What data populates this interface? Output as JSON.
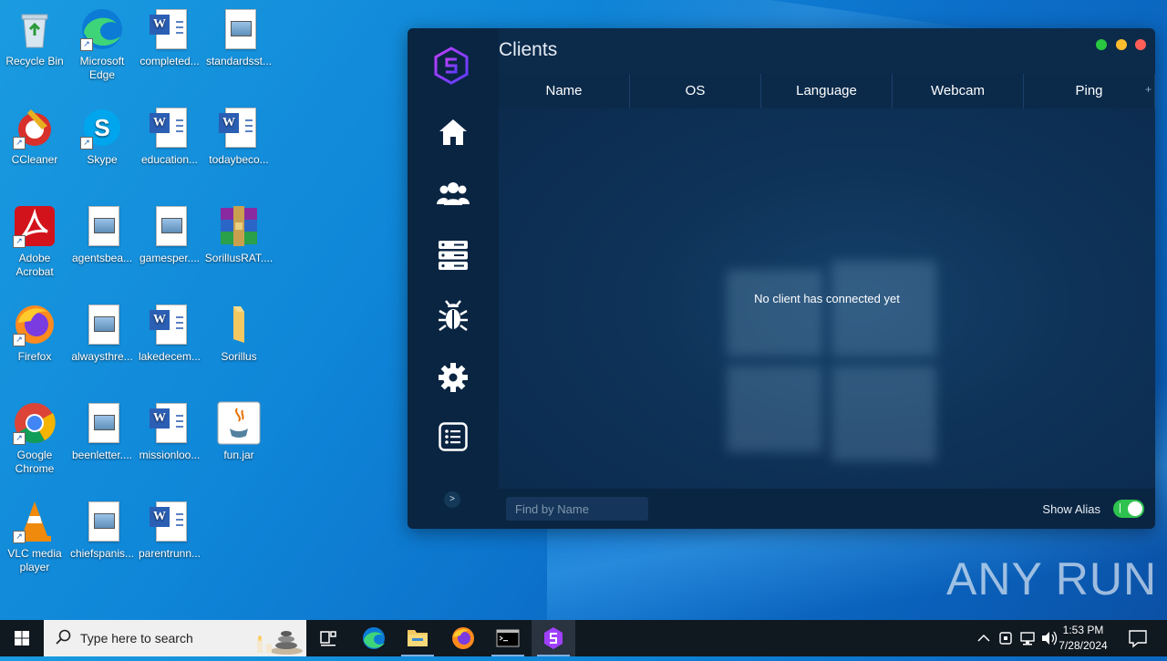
{
  "desktop": {
    "icons": [
      {
        "label": "Recycle Bin"
      },
      {
        "label": "Microsoft Edge"
      },
      {
        "label": "completed..."
      },
      {
        "label": "standardsst..."
      },
      {
        "label": "CCleaner"
      },
      {
        "label": "Skype"
      },
      {
        "label": "education..."
      },
      {
        "label": "todaybeco..."
      },
      {
        "label": "Adobe Acrobat"
      },
      {
        "label": "agentsbea..."
      },
      {
        "label": "gamesper...."
      },
      {
        "label": "SorillusRAT...."
      },
      {
        "label": "Firefox"
      },
      {
        "label": "alwaysthre..."
      },
      {
        "label": "lakedecem..."
      },
      {
        "label": "Sorillus"
      },
      {
        "label": "Google Chrome"
      },
      {
        "label": "beenletter...."
      },
      {
        "label": "missionloo..."
      },
      {
        "label": "fun.jar"
      },
      {
        "label": "VLC media player"
      },
      {
        "label": "chiefspanis..."
      },
      {
        "label": "parentrunn..."
      }
    ]
  },
  "app": {
    "title": "Clients",
    "columns": [
      "Name",
      "OS",
      "Language",
      "Webcam",
      "Ping"
    ],
    "add_column": "+",
    "empty_message": "No client has connected yet",
    "search_placeholder": "Find by Name",
    "show_alias_label": "Show Alias",
    "show_alias_on": true,
    "expand_label": ">",
    "colors": {
      "accent_green": "#2ec24f",
      "dot_green": "#28c840",
      "dot_yellow": "#febc2e",
      "dot_red": "#ff5f57",
      "logo_purple": "#a040ff"
    }
  },
  "watermark": "ANY RUN",
  "taskbar": {
    "search_placeholder": "Type here to search",
    "time": "1:53 PM",
    "date": "7/28/2024"
  }
}
